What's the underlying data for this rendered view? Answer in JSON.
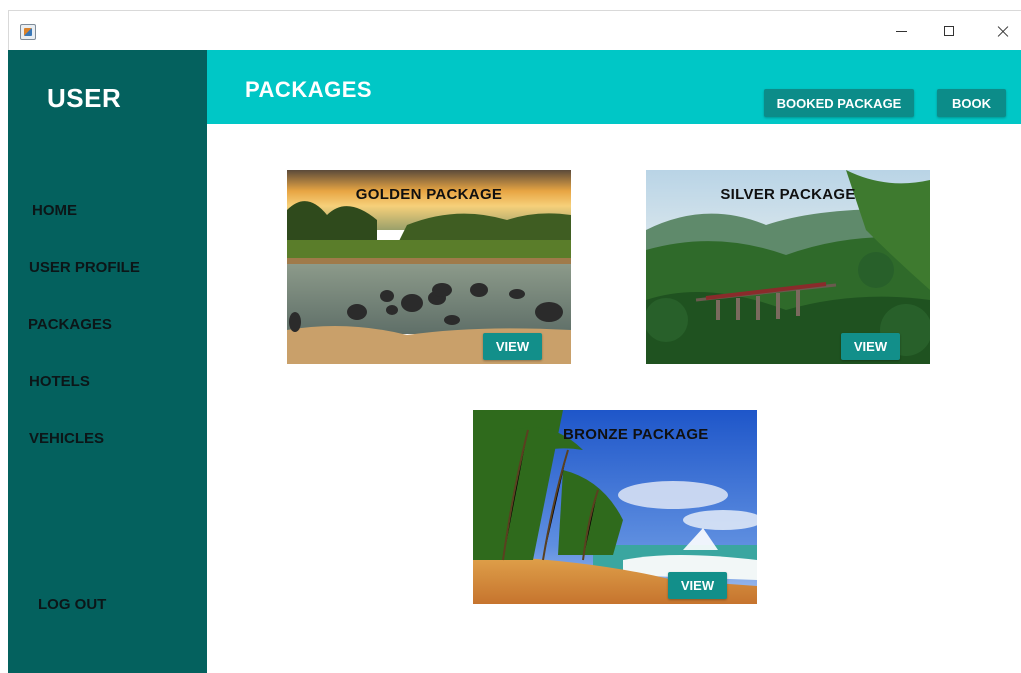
{
  "window": {
    "app_icon": "java-cup-icon",
    "controls": [
      "minimize-icon",
      "maximize-icon",
      "close-icon"
    ]
  },
  "sidebar": {
    "title": "USER",
    "items": [
      {
        "label": "HOME"
      },
      {
        "label": "USER PROFILE"
      },
      {
        "label": "PACKAGES"
      },
      {
        "label": "HOTELS"
      },
      {
        "label": "VEHICLES"
      }
    ],
    "logout_label": "LOG OUT"
  },
  "header": {
    "title": "PACKAGES",
    "booked_package_label": "BOOKED PACKAGE",
    "book_label": "BOOK"
  },
  "packages": [
    {
      "name": "GOLDEN PACKAGE",
      "view_label": "VIEW"
    },
    {
      "name": "SILVER PACKAGE",
      "view_label": "VIEW"
    },
    {
      "name": "BRONZE PACKAGE",
      "view_label": "VIEW"
    }
  ],
  "colors": {
    "sidebar": "#04615e",
    "header": "#00c7c6",
    "button": "#0c8c89"
  }
}
